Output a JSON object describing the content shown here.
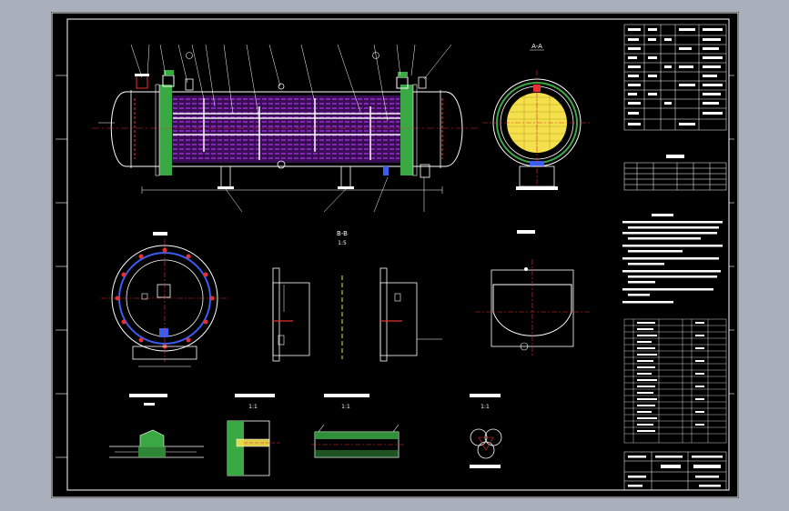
{
  "views": {
    "section_a": {
      "title": "A-A"
    },
    "section_b": {
      "title": "B-B"
    },
    "section_b_scale": "1:5",
    "section_b2": {
      "title": "B-B"
    },
    "tube_scale": "1:1",
    "weld_scale": "1:1",
    "mark_scale": "1:1"
  },
  "colors": {
    "sheet": "#000000",
    "frame": "#ffffff",
    "tube_bundle": "#9b2fd6",
    "tube_sheet": "#3aa843",
    "baffle": "#f1f1f1",
    "tube_face": "#f4e04a",
    "nozzle_red": "#e83030",
    "nozzle_blue": "#3a5df0",
    "dim_line": "#1aa1c9"
  }
}
